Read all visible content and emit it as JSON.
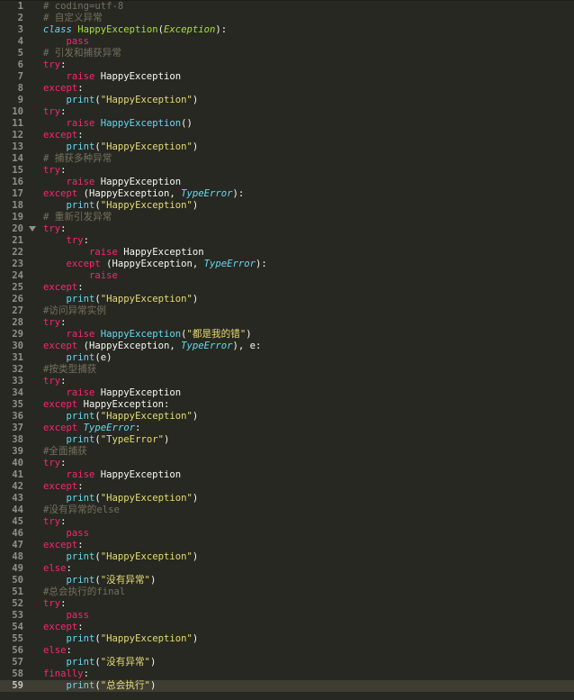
{
  "editor": {
    "theme": {
      "background": "#272822",
      "comment": "#75715e",
      "keyword": "#f92672",
      "string": "#e6db74",
      "class_name": "#a6e22e",
      "builtin": "#66d9ef",
      "text": "#f8f8f2",
      "gutter_text": "#8f908a"
    },
    "active_line": 59,
    "fold_marker_line": 20,
    "lines": [
      {
        "n": "1",
        "indent": "",
        "tokens": [
          {
            "t": "# coding=utf-8",
            "c": "cm"
          }
        ]
      },
      {
        "n": "2",
        "indent": "",
        "tokens": [
          {
            "t": "# 自定义异常",
            "c": "cm"
          }
        ]
      },
      {
        "n": "3",
        "indent": "",
        "tokens": [
          {
            "t": "class",
            "c": "de"
          },
          {
            "t": " ",
            "c": "pl"
          },
          {
            "t": "HappyException",
            "c": "cl"
          },
          {
            "t": "(",
            "c": "pl"
          },
          {
            "t": "Exception",
            "c": "pa"
          },
          {
            "t": "):",
            "c": "pl"
          }
        ]
      },
      {
        "n": "4",
        "indent": "    ",
        "tokens": [
          {
            "t": "pass",
            "c": "kw"
          }
        ]
      },
      {
        "n": "5",
        "indent": "",
        "tokens": [
          {
            "t": "# 引发和捕获异常",
            "c": "cm"
          }
        ]
      },
      {
        "n": "6",
        "indent": "",
        "tokens": [
          {
            "t": "try",
            "c": "kw"
          },
          {
            "t": ":",
            "c": "pl"
          }
        ]
      },
      {
        "n": "7",
        "indent": "    ",
        "tokens": [
          {
            "t": "raise",
            "c": "kw"
          },
          {
            "t": " HappyException",
            "c": "pl"
          }
        ]
      },
      {
        "n": "8",
        "indent": "",
        "tokens": [
          {
            "t": "except",
            "c": "kw"
          },
          {
            "t": ":",
            "c": "pl"
          }
        ]
      },
      {
        "n": "9",
        "indent": "    ",
        "tokens": [
          {
            "t": "print",
            "c": "fn"
          },
          {
            "t": "(",
            "c": "pl"
          },
          {
            "t": "\"HappyException\"",
            "c": "st"
          },
          {
            "t": ")",
            "c": "pl"
          }
        ]
      },
      {
        "n": "10",
        "indent": "",
        "tokens": [
          {
            "t": "try",
            "c": "kw"
          },
          {
            "t": ":",
            "c": "pl"
          }
        ]
      },
      {
        "n": "11",
        "indent": "    ",
        "tokens": [
          {
            "t": "raise",
            "c": "kw"
          },
          {
            "t": " ",
            "c": "pl"
          },
          {
            "t": "HappyException",
            "c": "fn"
          },
          {
            "t": "()",
            "c": "pl"
          }
        ]
      },
      {
        "n": "12",
        "indent": "",
        "tokens": [
          {
            "t": "except",
            "c": "kw"
          },
          {
            "t": ":",
            "c": "pl"
          }
        ]
      },
      {
        "n": "13",
        "indent": "    ",
        "tokens": [
          {
            "t": "print",
            "c": "fn"
          },
          {
            "t": "(",
            "c": "pl"
          },
          {
            "t": "\"HappyException\"",
            "c": "st"
          },
          {
            "t": ")",
            "c": "pl"
          }
        ]
      },
      {
        "n": "14",
        "indent": "",
        "tokens": [
          {
            "t": "# 捕获多种异常",
            "c": "cm"
          }
        ]
      },
      {
        "n": "15",
        "indent": "",
        "tokens": [
          {
            "t": "try",
            "c": "kw"
          },
          {
            "t": ":",
            "c": "pl"
          }
        ]
      },
      {
        "n": "16",
        "indent": "    ",
        "tokens": [
          {
            "t": "raise",
            "c": "kw"
          },
          {
            "t": " HappyException",
            "c": "pl"
          }
        ]
      },
      {
        "n": "17",
        "indent": "",
        "tokens": [
          {
            "t": "except",
            "c": "kw"
          },
          {
            "t": " (HappyException, ",
            "c": "pl"
          },
          {
            "t": "TypeError",
            "c": "bi"
          },
          {
            "t": "):",
            "c": "pl"
          }
        ]
      },
      {
        "n": "18",
        "indent": "    ",
        "tokens": [
          {
            "t": "print",
            "c": "fn"
          },
          {
            "t": "(",
            "c": "pl"
          },
          {
            "t": "\"HappyException\"",
            "c": "st"
          },
          {
            "t": ")",
            "c": "pl"
          }
        ]
      },
      {
        "n": "19",
        "indent": "",
        "tokens": [
          {
            "t": "# 重新引发异常",
            "c": "cm"
          }
        ]
      },
      {
        "n": "20",
        "indent": "",
        "tokens": [
          {
            "t": "try",
            "c": "kw"
          },
          {
            "t": ":",
            "c": "pl"
          }
        ]
      },
      {
        "n": "21",
        "indent": "    ",
        "tokens": [
          {
            "t": "try",
            "c": "kw"
          },
          {
            "t": ":",
            "c": "pl"
          }
        ]
      },
      {
        "n": "22",
        "indent": "        ",
        "tokens": [
          {
            "t": "raise",
            "c": "kw"
          },
          {
            "t": " HappyException",
            "c": "pl"
          }
        ]
      },
      {
        "n": "23",
        "indent": "    ",
        "tokens": [
          {
            "t": "except",
            "c": "kw"
          },
          {
            "t": " (HappyException, ",
            "c": "pl"
          },
          {
            "t": "TypeError",
            "c": "bi"
          },
          {
            "t": "):",
            "c": "pl"
          }
        ]
      },
      {
        "n": "24",
        "indent": "        ",
        "tokens": [
          {
            "t": "raise",
            "c": "kw"
          }
        ]
      },
      {
        "n": "25",
        "indent": "",
        "tokens": [
          {
            "t": "except",
            "c": "kw"
          },
          {
            "t": ":",
            "c": "pl"
          }
        ]
      },
      {
        "n": "26",
        "indent": "    ",
        "tokens": [
          {
            "t": "print",
            "c": "fn"
          },
          {
            "t": "(",
            "c": "pl"
          },
          {
            "t": "\"HappyException\"",
            "c": "st"
          },
          {
            "t": ")",
            "c": "pl"
          }
        ]
      },
      {
        "n": "27",
        "indent": "",
        "tokens": [
          {
            "t": "#访问异常实例",
            "c": "cm"
          }
        ]
      },
      {
        "n": "28",
        "indent": "",
        "tokens": [
          {
            "t": "try",
            "c": "kw"
          },
          {
            "t": ":",
            "c": "pl"
          }
        ]
      },
      {
        "n": "29",
        "indent": "    ",
        "tokens": [
          {
            "t": "raise",
            "c": "kw"
          },
          {
            "t": " ",
            "c": "pl"
          },
          {
            "t": "HappyException",
            "c": "fn"
          },
          {
            "t": "(",
            "c": "pl"
          },
          {
            "t": "\"都是我的错\"",
            "c": "st"
          },
          {
            "t": ")",
            "c": "pl"
          }
        ]
      },
      {
        "n": "30",
        "indent": "",
        "tokens": [
          {
            "t": "except",
            "c": "kw"
          },
          {
            "t": " (HappyException, ",
            "c": "pl"
          },
          {
            "t": "TypeError",
            "c": "bi"
          },
          {
            "t": "), e:",
            "c": "pl"
          }
        ]
      },
      {
        "n": "31",
        "indent": "    ",
        "tokens": [
          {
            "t": "print",
            "c": "fn"
          },
          {
            "t": "(e)",
            "c": "pl"
          }
        ]
      },
      {
        "n": "32",
        "indent": "",
        "tokens": [
          {
            "t": "#按类型捕获",
            "c": "cm"
          }
        ]
      },
      {
        "n": "33",
        "indent": "",
        "tokens": [
          {
            "t": "try",
            "c": "kw"
          },
          {
            "t": ":",
            "c": "pl"
          }
        ]
      },
      {
        "n": "34",
        "indent": "    ",
        "tokens": [
          {
            "t": "raise",
            "c": "kw"
          },
          {
            "t": " HappyException",
            "c": "pl"
          }
        ]
      },
      {
        "n": "35",
        "indent": "",
        "tokens": [
          {
            "t": "except",
            "c": "kw"
          },
          {
            "t": " HappyException:",
            "c": "pl"
          }
        ]
      },
      {
        "n": "36",
        "indent": "    ",
        "tokens": [
          {
            "t": "print",
            "c": "fn"
          },
          {
            "t": "(",
            "c": "pl"
          },
          {
            "t": "\"HappyException\"",
            "c": "st"
          },
          {
            "t": ")",
            "c": "pl"
          }
        ]
      },
      {
        "n": "37",
        "indent": "",
        "tokens": [
          {
            "t": "except",
            "c": "kw"
          },
          {
            "t": " ",
            "c": "pl"
          },
          {
            "t": "TypeError",
            "c": "bi"
          },
          {
            "t": ":",
            "c": "pl"
          }
        ]
      },
      {
        "n": "38",
        "indent": "    ",
        "tokens": [
          {
            "t": "print",
            "c": "fn"
          },
          {
            "t": "(",
            "c": "pl"
          },
          {
            "t": "\"TypeError\"",
            "c": "st"
          },
          {
            "t": ")",
            "c": "pl"
          }
        ]
      },
      {
        "n": "39",
        "indent": "",
        "tokens": [
          {
            "t": "#全面捕获",
            "c": "cm"
          }
        ]
      },
      {
        "n": "40",
        "indent": "",
        "tokens": [
          {
            "t": "try",
            "c": "kw"
          },
          {
            "t": ":",
            "c": "pl"
          }
        ]
      },
      {
        "n": "41",
        "indent": "    ",
        "tokens": [
          {
            "t": "raise",
            "c": "kw"
          },
          {
            "t": " HappyException",
            "c": "pl"
          }
        ]
      },
      {
        "n": "42",
        "indent": "",
        "tokens": [
          {
            "t": "except",
            "c": "kw"
          },
          {
            "t": ":",
            "c": "pl"
          }
        ]
      },
      {
        "n": "43",
        "indent": "    ",
        "tokens": [
          {
            "t": "print",
            "c": "fn"
          },
          {
            "t": "(",
            "c": "pl"
          },
          {
            "t": "\"HappyException\"",
            "c": "st"
          },
          {
            "t": ")",
            "c": "pl"
          }
        ]
      },
      {
        "n": "44",
        "indent": "",
        "tokens": [
          {
            "t": "#没有异常的else",
            "c": "cm"
          }
        ]
      },
      {
        "n": "45",
        "indent": "",
        "tokens": [
          {
            "t": "try",
            "c": "kw"
          },
          {
            "t": ":",
            "c": "pl"
          }
        ]
      },
      {
        "n": "46",
        "indent": "    ",
        "tokens": [
          {
            "t": "pass",
            "c": "kw"
          }
        ]
      },
      {
        "n": "47",
        "indent": "",
        "tokens": [
          {
            "t": "except",
            "c": "kw"
          },
          {
            "t": ":",
            "c": "pl"
          }
        ]
      },
      {
        "n": "48",
        "indent": "    ",
        "tokens": [
          {
            "t": "print",
            "c": "fn"
          },
          {
            "t": "(",
            "c": "pl"
          },
          {
            "t": "\"HappyException\"",
            "c": "st"
          },
          {
            "t": ")",
            "c": "pl"
          }
        ]
      },
      {
        "n": "49",
        "indent": "",
        "tokens": [
          {
            "t": "else",
            "c": "kw"
          },
          {
            "t": ":",
            "c": "pl"
          }
        ]
      },
      {
        "n": "50",
        "indent": "    ",
        "tokens": [
          {
            "t": "print",
            "c": "fn"
          },
          {
            "t": "(",
            "c": "pl"
          },
          {
            "t": "\"没有异常\"",
            "c": "st"
          },
          {
            "t": ")",
            "c": "pl"
          }
        ]
      },
      {
        "n": "51",
        "indent": "",
        "tokens": [
          {
            "t": "#总会执行的final",
            "c": "cm"
          }
        ]
      },
      {
        "n": "52",
        "indent": "",
        "tokens": [
          {
            "t": "try",
            "c": "kw"
          },
          {
            "t": ":",
            "c": "pl"
          }
        ]
      },
      {
        "n": "53",
        "indent": "    ",
        "tokens": [
          {
            "t": "pass",
            "c": "kw"
          }
        ]
      },
      {
        "n": "54",
        "indent": "",
        "tokens": [
          {
            "t": "except",
            "c": "kw"
          },
          {
            "t": ":",
            "c": "pl"
          }
        ]
      },
      {
        "n": "55",
        "indent": "    ",
        "tokens": [
          {
            "t": "print",
            "c": "fn"
          },
          {
            "t": "(",
            "c": "pl"
          },
          {
            "t": "\"HappyException\"",
            "c": "st"
          },
          {
            "t": ")",
            "c": "pl"
          }
        ]
      },
      {
        "n": "56",
        "indent": "",
        "tokens": [
          {
            "t": "else",
            "c": "kw"
          },
          {
            "t": ":",
            "c": "pl"
          }
        ]
      },
      {
        "n": "57",
        "indent": "    ",
        "tokens": [
          {
            "t": "print",
            "c": "fn"
          },
          {
            "t": "(",
            "c": "pl"
          },
          {
            "t": "\"没有异常\"",
            "c": "st"
          },
          {
            "t": ")",
            "c": "pl"
          }
        ]
      },
      {
        "n": "58",
        "indent": "",
        "tokens": [
          {
            "t": "finally",
            "c": "kw"
          },
          {
            "t": ":",
            "c": "pl"
          }
        ]
      },
      {
        "n": "59",
        "indent": "    ",
        "tokens": [
          {
            "t": "print",
            "c": "fn"
          },
          {
            "t": "(",
            "c": "pl"
          },
          {
            "t": "\"总会执行\"",
            "c": "st"
          },
          {
            "t": ")",
            "c": "pl"
          }
        ]
      }
    ]
  }
}
